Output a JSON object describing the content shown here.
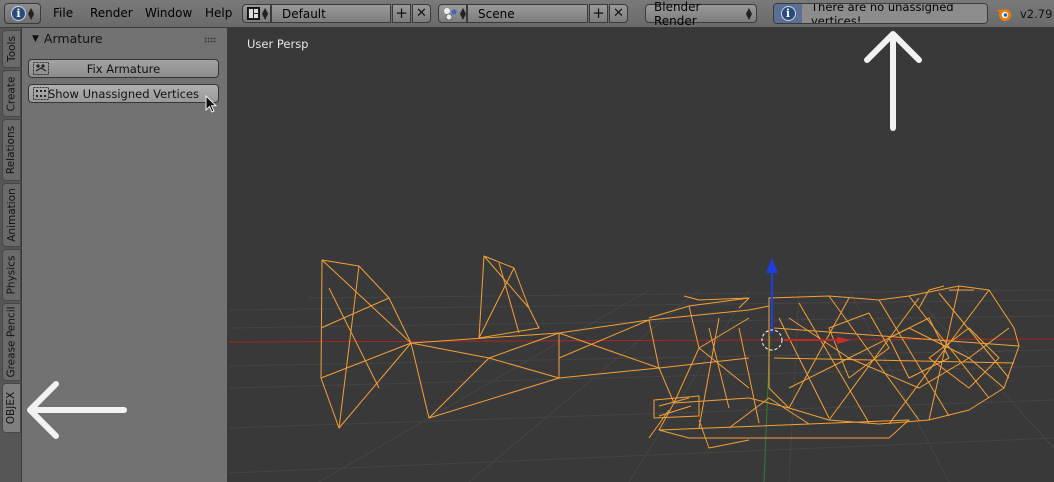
{
  "header": {
    "menus": [
      "File",
      "Render",
      "Window",
      "Help"
    ],
    "screen_layout": "Default",
    "scene": "Scene",
    "render_engine": "Blender Render",
    "report_message": "There are no unassigned vertices!",
    "version": "v2.79"
  },
  "tabs": [
    "Tools",
    "Create",
    "Relations",
    "Animation",
    "Physics",
    "Grease Pencil",
    "OBJEX"
  ],
  "active_tab": "OBJEX",
  "panel": {
    "title": "Armature",
    "buttons": [
      "Fix Armature",
      "Show Unassigned Vertices"
    ]
  },
  "viewport": {
    "label": "User Persp"
  },
  "colors": {
    "header_bg": "#707070",
    "viewport_bg": "#393939",
    "wireframe": "#f2a03a",
    "x_axis": "#c02a2a",
    "z_axis": "#1e3fe0",
    "y_axis": "#3a9a3a",
    "report_icon_bg": "#5a6e96"
  }
}
